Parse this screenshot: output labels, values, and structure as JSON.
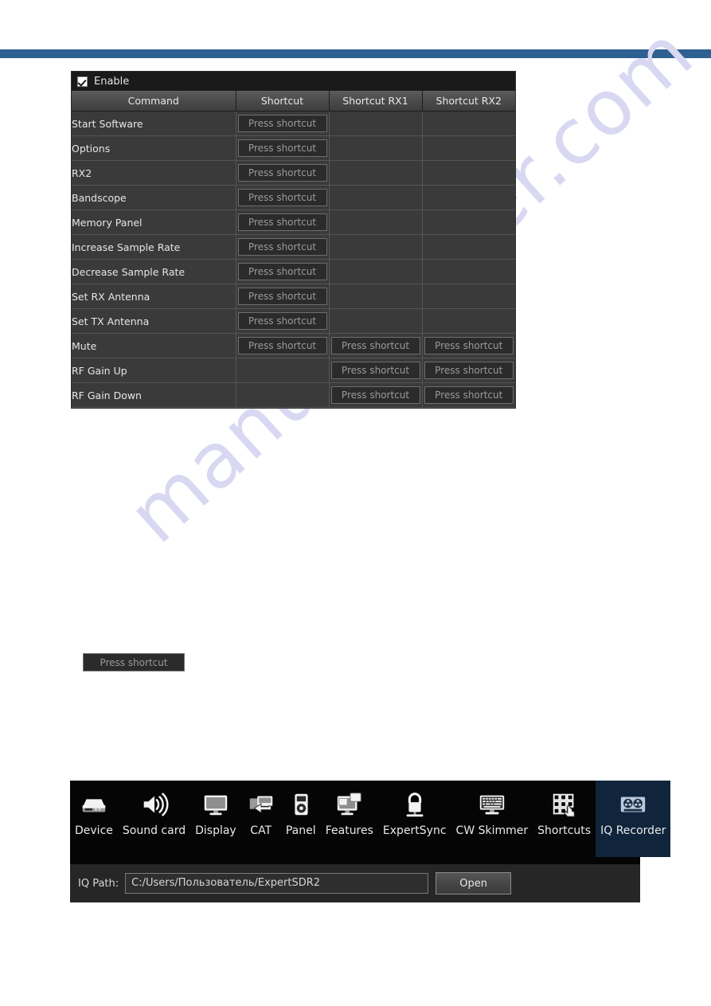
{
  "theme": {
    "accent_blue": "#2e6091",
    "selected_tile": "#10243c",
    "panel_bg": "#1a1a1a",
    "table_bg": "#3a3a3a",
    "header_grey": "#4a4a4a"
  },
  "watermark": {
    "text": "manualshiver.com"
  },
  "shortcuts_panel": {
    "enable": {
      "label": "Enable",
      "checked": true
    },
    "columns": [
      "Command",
      "Shortcut",
      "Shortcut RX1",
      "Shortcut RX2"
    ],
    "press_label": "Press shortcut",
    "rows": [
      {
        "command": "Start Software",
        "shortcut": "Press shortcut",
        "rx1": "",
        "rx2": ""
      },
      {
        "command": "Options",
        "shortcut": "Press shortcut",
        "rx1": "",
        "rx2": ""
      },
      {
        "command": "RX2",
        "shortcut": "Press shortcut",
        "rx1": "",
        "rx2": ""
      },
      {
        "command": "Bandscope",
        "shortcut": "Press shortcut",
        "rx1": "",
        "rx2": ""
      },
      {
        "command": "Memory Panel",
        "shortcut": "Press shortcut",
        "rx1": "",
        "rx2": ""
      },
      {
        "command": "Increase Sample Rate",
        "shortcut": "Press shortcut",
        "rx1": "",
        "rx2": ""
      },
      {
        "command": "Decrease Sample Rate",
        "shortcut": "Press shortcut",
        "rx1": "",
        "rx2": ""
      },
      {
        "command": "Set RX Antenna",
        "shortcut": "Press shortcut",
        "rx1": "",
        "rx2": ""
      },
      {
        "command": "Set TX Antenna",
        "shortcut": "Press shortcut",
        "rx1": "",
        "rx2": ""
      },
      {
        "command": "Mute",
        "shortcut": "Press shortcut",
        "rx1": "Press shortcut",
        "rx2": "Press shortcut"
      },
      {
        "command": "RF Gain Up",
        "shortcut": "",
        "rx1": "Press shortcut",
        "rx2": "Press shortcut"
      },
      {
        "command": "RF Gain Down",
        "shortcut": "",
        "rx1": "Press shortcut",
        "rx2": "Press shortcut"
      }
    ]
  },
  "floating_button": {
    "label": "Press shortcut"
  },
  "settings_window": {
    "toolbar": [
      {
        "label": "Device",
        "icon": "hard-drive-icon",
        "selected": false
      },
      {
        "label": "Sound card",
        "icon": "speaker-icon",
        "selected": false
      },
      {
        "label": "Display",
        "icon": "monitor-icon",
        "selected": false
      },
      {
        "label": "CAT",
        "icon": "cat-transfer-icon",
        "selected": false
      },
      {
        "label": "Panel",
        "icon": "panel-device-icon",
        "selected": false
      },
      {
        "label": "Features",
        "icon": "two-monitors-icon",
        "selected": false
      },
      {
        "label": "ExpertSync",
        "icon": "lock-icon",
        "selected": false
      },
      {
        "label": "CW Skimmer",
        "icon": "keyboard-icon",
        "selected": false
      },
      {
        "label": "Shortcuts",
        "icon": "keypad-hand-icon",
        "selected": false
      },
      {
        "label": "IQ Recorder",
        "icon": "tape-reels-icon",
        "selected": true
      }
    ],
    "iq_path": {
      "label": "IQ Path:",
      "value": "C:/Users/Пользователь/ExpertSDR2",
      "open_button": "Open"
    }
  }
}
